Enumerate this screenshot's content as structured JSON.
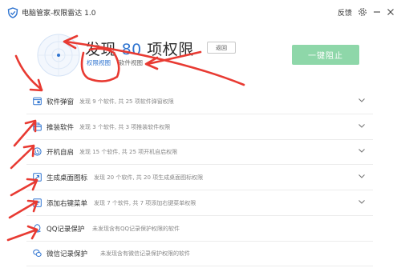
{
  "window": {
    "title": "电脑管家-权限雷达 1.0",
    "feedback_label": "反馈",
    "icons": [
      "shield-logo-icon",
      "gear-icon",
      "minimize-icon",
      "close-icon"
    ]
  },
  "header": {
    "headline_prefix": "发现",
    "headline_count": "80",
    "headline_suffix": "项权限",
    "back_label": "返回",
    "tabs": [
      {
        "label": "权限视图",
        "active": true
      },
      {
        "label": "软件视图",
        "active": false
      }
    ],
    "block_all_label": "一键阻止"
  },
  "categories": [
    {
      "title": "软件弹窗",
      "desc": "发现 9 个软件, 共 25 项软件弹窗权限",
      "icon": "popup-window-icon",
      "expandable": true
    },
    {
      "title": "推装软件",
      "desc": "发现 3 个软件, 共 3 项推装软件权限",
      "icon": "install-package-icon",
      "expandable": true
    },
    {
      "title": "开机自启",
      "desc": "发现 15 个软件, 共 25 项开机自启权限",
      "icon": "power-startup-icon",
      "expandable": true
    },
    {
      "title": "生成桌面图标",
      "desc": "发现 20 个软件, 共 20 项生成桌面图标权限",
      "icon": "desktop-shortcut-icon",
      "expandable": true
    },
    {
      "title": "添加右键菜单",
      "desc": "发现 7 个软件, 共 7 项添加右键菜单权限",
      "icon": "context-menu-icon",
      "expandable": true
    },
    {
      "title": "QQ记录保护",
      "desc": "未发现含有QQ记录保护权限的软件",
      "icon": "qq-icon",
      "expandable": false
    },
    {
      "title": "微信记录保护",
      "desc": "未发现含有微信记录保护权限的软件",
      "icon": "wechat-icon",
      "expandable": false
    }
  ],
  "colors": {
    "accent": "#2f74d0",
    "block_button": "#8ed7a9",
    "annotation_red": "#e83a32"
  }
}
